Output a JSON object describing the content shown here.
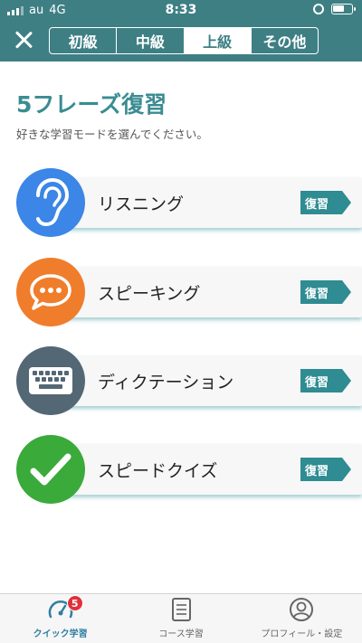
{
  "status_bar": {
    "carrier": "au",
    "network": "4G",
    "time": "8:33"
  },
  "header": {
    "levels": [
      {
        "label": "初級",
        "active": false
      },
      {
        "label": "中級",
        "active": false
      },
      {
        "label": "上級",
        "active": true
      },
      {
        "label": "その他",
        "active": false
      }
    ]
  },
  "page": {
    "title": "5フレーズ復習",
    "subtitle": "好きな学習モードを選んでください。"
  },
  "modes": [
    {
      "label": "リスニング",
      "action": "復習",
      "icon": "ear-icon",
      "color": "#3b86e6"
    },
    {
      "label": "スピーキング",
      "action": "復習",
      "icon": "speech-bubble-icon",
      "color": "#f07d2b"
    },
    {
      "label": "ディクテーション",
      "action": "復習",
      "icon": "keyboard-icon",
      "color": "#536775"
    },
    {
      "label": "スピードクイズ",
      "action": "復習",
      "icon": "checkmark-icon",
      "color": "#3aaa3a"
    }
  ],
  "tabbar": {
    "items": [
      {
        "label": "クイック学習",
        "icon": "speedometer-icon",
        "badge": "5",
        "active": true
      },
      {
        "label": "コース学習",
        "icon": "notebook-icon",
        "active": false
      },
      {
        "label": "プロフィール・設定",
        "icon": "profile-icon",
        "active": false
      }
    ]
  },
  "colors": {
    "header": "#3e7f84",
    "accent": "#2e8c92",
    "active_tab": "#2f7ea4"
  }
}
